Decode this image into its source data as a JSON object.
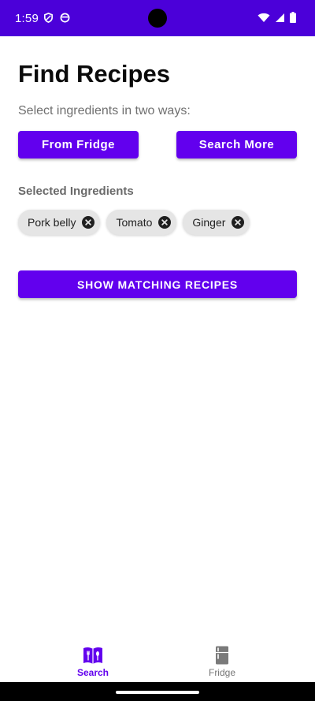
{
  "status_bar": {
    "time": "1:59",
    "background": "#4b00d9",
    "left_icons": [
      "shield-icon",
      "data-saver-icon"
    ],
    "right_icons": [
      "wifi-icon",
      "cell-signal-icon",
      "battery-icon"
    ]
  },
  "header": {
    "title": "Find Recipes",
    "subtitle": "Select ingredients in two ways:"
  },
  "actions": {
    "from_fridge_label": "From Fridge",
    "search_more_label": "Search More"
  },
  "selected": {
    "heading": "Selected Ingredients",
    "ingredients": [
      {
        "label": "Pork belly",
        "icon": "close-circle-icon"
      },
      {
        "label": "Tomato",
        "icon": "close-circle-icon"
      },
      {
        "label": "Ginger",
        "icon": "close-circle-icon"
      }
    ]
  },
  "show_button_label": "SHOW MATCHING RECIPES",
  "bottom_nav": {
    "items": [
      {
        "label": "Search",
        "icon": "recipe-book-icon",
        "active": true
      },
      {
        "label": "Fridge",
        "icon": "fridge-icon",
        "active": false
      }
    ]
  },
  "colors": {
    "accent": "#6200ee",
    "status_bar": "#4b00d9",
    "chip_bg": "#e5e5e5",
    "inactive_nav": "#757575"
  }
}
